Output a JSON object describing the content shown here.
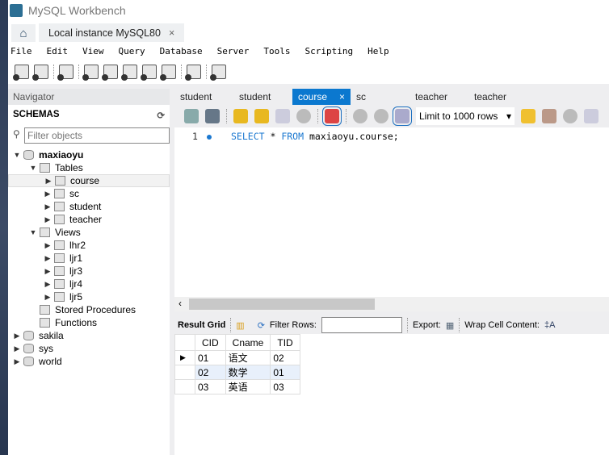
{
  "app": {
    "title": "MySQL Workbench"
  },
  "connection_tab": {
    "label": "Local instance MySQL80",
    "close": "×"
  },
  "menu": [
    "File",
    "Edit",
    "View",
    "Query",
    "Database",
    "Server",
    "Tools",
    "Scripting",
    "Help"
  ],
  "navigator": {
    "header": "Navigator",
    "section": "SCHEMAS",
    "filter_placeholder": "Filter objects",
    "schema": "maxiaoyu",
    "tables_label": "Tables",
    "tables": [
      "course",
      "sc",
      "student",
      "teacher"
    ],
    "views_label": "Views",
    "views": [
      "lhr2",
      "ljr1",
      "ljr3",
      "ljr4",
      "ljr5"
    ],
    "procedures_label": "Stored Procedures",
    "functions_label": "Functions",
    "other_schemas": [
      "sakila",
      "sys",
      "world"
    ]
  },
  "editor_tabs": [
    {
      "label": "student"
    },
    {
      "label": "student"
    },
    {
      "label": "course",
      "active": true
    },
    {
      "label": "sc"
    },
    {
      "label": "teacher"
    },
    {
      "label": "teacher"
    }
  ],
  "editor": {
    "limit": "Limit to 1000 rows",
    "line": "1",
    "kw1": "SELECT",
    "mid": " * ",
    "kw2": "FROM",
    "rest": " maxiaoyu.course;"
  },
  "result": {
    "grid_label": "Result Grid",
    "filter_label": "Filter Rows:",
    "filter_value": "",
    "export_label": "Export:",
    "wrap_label": "Wrap Cell Content:",
    "columns": [
      "CID",
      "Cname",
      "TID"
    ],
    "rows": [
      [
        "01",
        "语文",
        "02"
      ],
      [
        "02",
        "数学",
        "01"
      ],
      [
        "03",
        "英语",
        "03"
      ]
    ]
  },
  "colors": {
    "accent": "#0b78cf"
  }
}
